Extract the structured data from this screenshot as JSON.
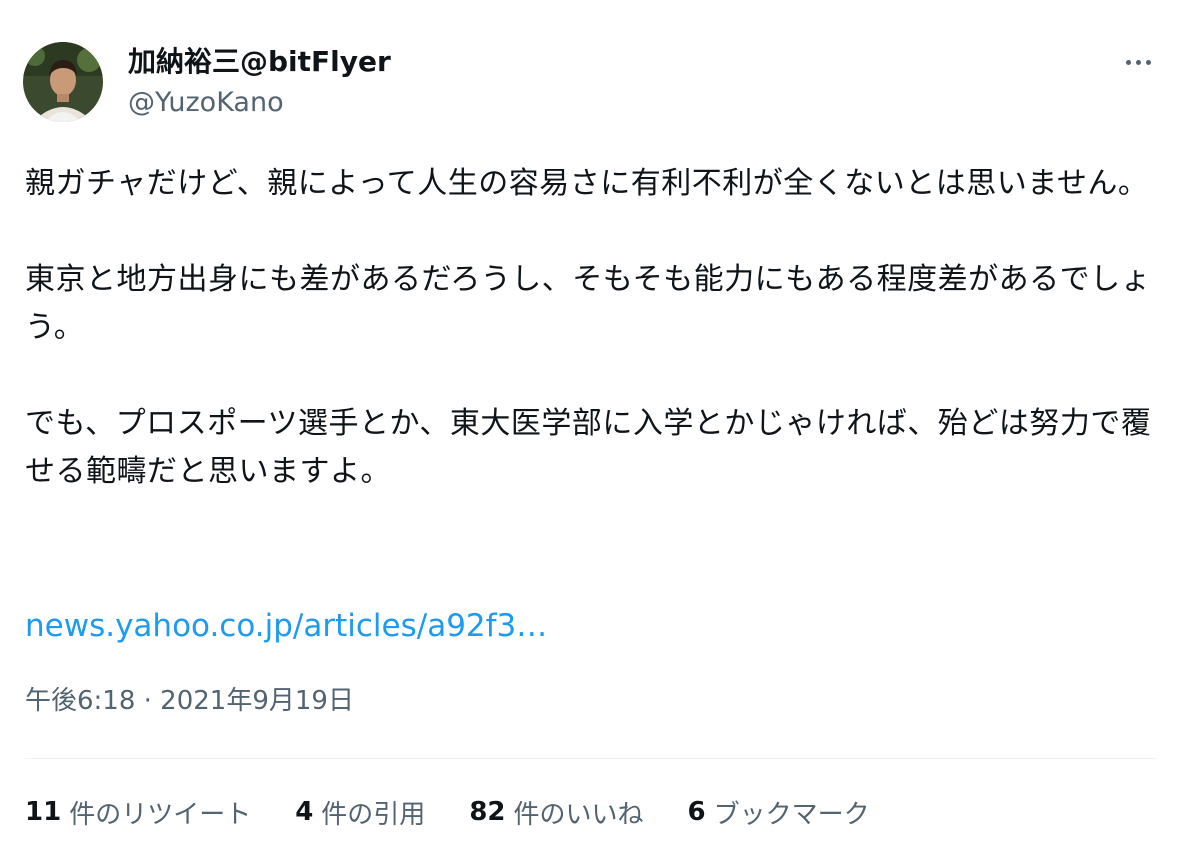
{
  "author": {
    "display_name": "加納裕三@bitFlyer",
    "handle": "@YuzoKano",
    "avatar_icon": "user-avatar-photo"
  },
  "menu": {
    "icon": "more-horizontal-icon"
  },
  "tweet": {
    "paragraphs": [
      "親ガチャだけど、親によって人生の容易さに有利不利が全くないとは思いません。",
      "東京と地方出身にも差があるだろうし、そもそも能力にもある程度差があるでしょう。",
      "でも、プロスポーツ選手とか、東大医学部に入学とかじゃければ、殆どは努力で覆せる範疇だと思いますよ。"
    ],
    "link": "news.yahoo.co.jp/articles/a92f3…",
    "timestamp": "午後6:18 · 2021年9月19日"
  },
  "stats": [
    {
      "count": "11",
      "label": "件のリツイート"
    },
    {
      "count": "4",
      "label": "件の引用"
    },
    {
      "count": "82",
      "label": "件のいいね"
    },
    {
      "count": "6",
      "label": "ブックマーク"
    }
  ],
  "colors": {
    "text": "#0f1419",
    "secondary": "#536471",
    "link": "#1d9bf0",
    "divider": "#eff3f4"
  }
}
